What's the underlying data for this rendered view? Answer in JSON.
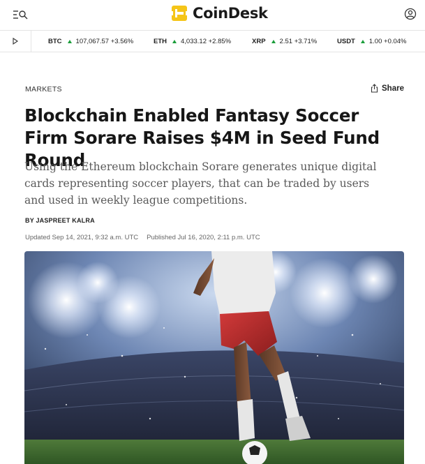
{
  "header": {
    "logo_text": "CoinDesk",
    "brand_color": "#f5c518"
  },
  "ticker": {
    "items": [
      {
        "symbol": "BTC",
        "price": "107,067.57",
        "change": "+3.56%"
      },
      {
        "symbol": "ETH",
        "price": "4,033.12",
        "change": "+2.85%"
      },
      {
        "symbol": "XRP",
        "price": "2.51",
        "change": "+3.71%"
      },
      {
        "symbol": "USDT",
        "price": "1.00",
        "change": "+0.04%"
      }
    ],
    "up_color": "#1a9d3a"
  },
  "article": {
    "category": "MARKETS",
    "share_label": "Share",
    "title": "Blockchain Enabled Fantasy Soccer Firm Sorare Raises $4M in Seed Fund Round",
    "subtitle": "Using the Ethereum blockchain Sorare generates unique digital cards representing soccer players, that can be traded by users and used in weekly league competitions.",
    "byline_prefix": "BY",
    "author": "JASPREET KALRA",
    "updated": "Updated Sep 14, 2021, 9:32 a.m. UTC",
    "published": "Published Jul 16, 2020, 2:11 p.m. UTC"
  }
}
